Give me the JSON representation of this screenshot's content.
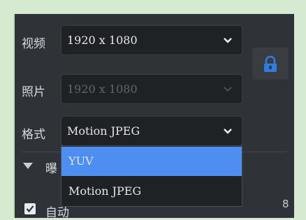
{
  "video": {
    "label": "视频",
    "value": "1920 x 1080"
  },
  "photo": {
    "label": "照片",
    "value": "1920 x 1080"
  },
  "format": {
    "label": "格式",
    "value": "Motion JPEG",
    "options": [
      "YUV",
      "Motion JPEG"
    ],
    "highlighted_option": "YUV"
  },
  "section": {
    "label": "曝"
  },
  "auto_checkbox": {
    "label": "自动",
    "checked": true
  },
  "value_number": "8",
  "colors": {
    "panel_bg": "#2f3236",
    "selected_option": "#4d8ef0",
    "lock_icon": "#2f7de1"
  },
  "icons": [
    "chevron-down-icon",
    "lock-icon",
    "triangle-down-icon",
    "checkmark-icon"
  ]
}
